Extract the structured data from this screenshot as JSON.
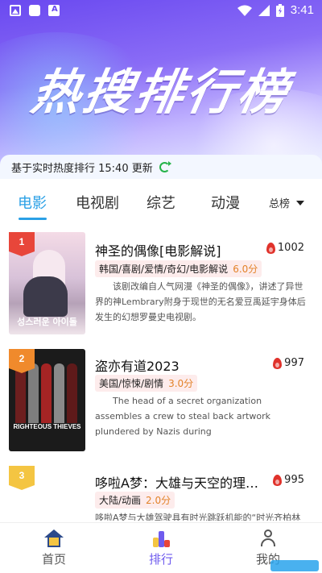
{
  "status_bar": {
    "time": "3:41"
  },
  "hero": {
    "title": "热搜排行榜"
  },
  "update": {
    "text": "基于实时热度排行 15:40 更新"
  },
  "tabs": [
    {
      "label": "电影",
      "active": true
    },
    {
      "label": "电视剧"
    },
    {
      "label": "综艺"
    },
    {
      "label": "动漫"
    }
  ],
  "rank_select": {
    "label": "总榜"
  },
  "items": [
    {
      "rank": "1",
      "title": "神圣的偶像[电影解说]",
      "heat": "1002",
      "tags": "韩国/喜剧/爱情/奇幻/电影解说",
      "score": "6.0分",
      "description": "该剧改编自人气网漫《神圣的偶像》，讲述了异世界的神Lembrary附身于现世的无名爱豆禹延宇身体后发生的幻想罗曼史电视剧。",
      "poster_text": "성스러운 아이돌"
    },
    {
      "rank": "2",
      "title": "盗亦有道2023",
      "heat": "997",
      "tags": "美国/惊悚/剧情",
      "score": "3.0分",
      "description": "The head of a secret organization assembles a crew to steal back artwork plundered by Nazis during",
      "poster_text": "RIGHTEOUS THIEVES"
    },
    {
      "rank": "3",
      "title": "哆啦A梦：大雄与天空的理想乡",
      "heat": "995",
      "tags": "大陆/动画",
      "score": "2.0分",
      "description": "哆啦A梦与大雄驾驶具有时光跳跃机能的“时光齐柏林"
    }
  ],
  "bottom_nav": [
    {
      "label": "首页"
    },
    {
      "label": "排行",
      "active": true
    },
    {
      "label": "我的"
    }
  ],
  "colors": {
    "accent": "#2aa0e6",
    "nav_active": "#6f5bee",
    "heat": "#e0322b",
    "score": "#e3832a",
    "rank1": "#e8463a",
    "rank2": "#f08a2c",
    "rank3": "#f4c542"
  }
}
